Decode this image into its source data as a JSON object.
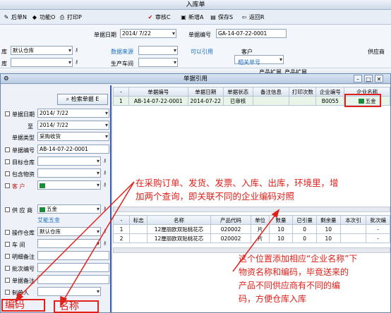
{
  "window": {
    "title": "入库单"
  },
  "toolbar": {
    "back": "后单N",
    "func": "功能O",
    "print": "打印P",
    "audit": "审核C",
    "add": "新增A",
    "save": "保存S",
    "return": "返回R"
  },
  "form": {
    "date_label": "单据日期",
    "date_value": "2014/ 7/22",
    "no_label": "单据编号",
    "no_value": "GA-14-07-22-0001",
    "warehouse_label": "库",
    "warehouse_value": "默认仓库",
    "source_label": "数据来源",
    "ref_link": "可以引用",
    "customer_label": "客户",
    "supplier_label": "供应商",
    "row2_label": "库",
    "workshop_label": "生产车间",
    "related_link": "相关单号",
    "col_a": "产品扩展",
    "col_b": "产品扩展"
  },
  "dialog": {
    "title": "单据引用",
    "search_btn": "检索单据 E",
    "filters": {
      "date": "单据日期",
      "date_from": "2014/ 7/22",
      "to": "至",
      "date_to": "2014/ 7/22",
      "type": "单据类型",
      "type_value": "采购收货",
      "no": "单据编号",
      "no_value": "AB-14-07-22-0001",
      "target_wh": "目标仓库",
      "pack": "包含物资",
      "customer": "客 户",
      "supplier": "供 应 商",
      "supplier_value": "五金",
      "supplier_name": "艾能五金",
      "op_wh": "操作仓库",
      "op_wh_value": "默认仓库",
      "workshop": "车 间",
      "detail_note": "明细备注",
      "batch_no": "批次编号",
      "doc_note": "单据备注",
      "maker": "制单人"
    },
    "top_table": {
      "headers": [
        "-",
        "单据编号",
        "单据日期",
        "单据状态",
        "备注信息",
        "打印次数",
        "企业编号",
        "企业名称"
      ],
      "rows": [
        [
          "1",
          "AB-14-07-22-0001",
          "2014-07-22",
          "已审核",
          "",
          "",
          "B0055",
          "五金"
        ]
      ]
    },
    "bottom_table": {
      "headers": [
        "-",
        "标志",
        "名称",
        "产品代码",
        "单位",
        "数量",
        "已引量",
        "剩余量",
        "本次引",
        "批次编"
      ],
      "rows": [
        [
          "1",
          "",
          "12厘丽欧双贴桃花芯",
          "020002",
          "片",
          "10",
          "0",
          "10",
          "",
          "-"
        ],
        [
          "2",
          "",
          "12厘丽欧双贴桃花芯",
          "020002",
          "片",
          "10",
          "0",
          "10",
          "",
          "-"
        ]
      ]
    }
  },
  "annotations": {
    "a1_line1": "在采购订单、发货、发票、入库、出库，环境里，增",
    "a1_line2": "加两个查询，即关联不同的企业编码对照",
    "a2_line1": "这个位置添加相应“企业名称”下",
    "a2_line2": "物资名称和编码，毕竟送来的",
    "a2_line3": "产品不同供应商有不同的编",
    "a2_line4": "码，方便仓库入库",
    "box_code": "编码",
    "box_name": "名称"
  },
  "colors": {
    "accent": "#3b5aa8",
    "annotation": "#e0201a",
    "tag": "#1f8a3c"
  }
}
